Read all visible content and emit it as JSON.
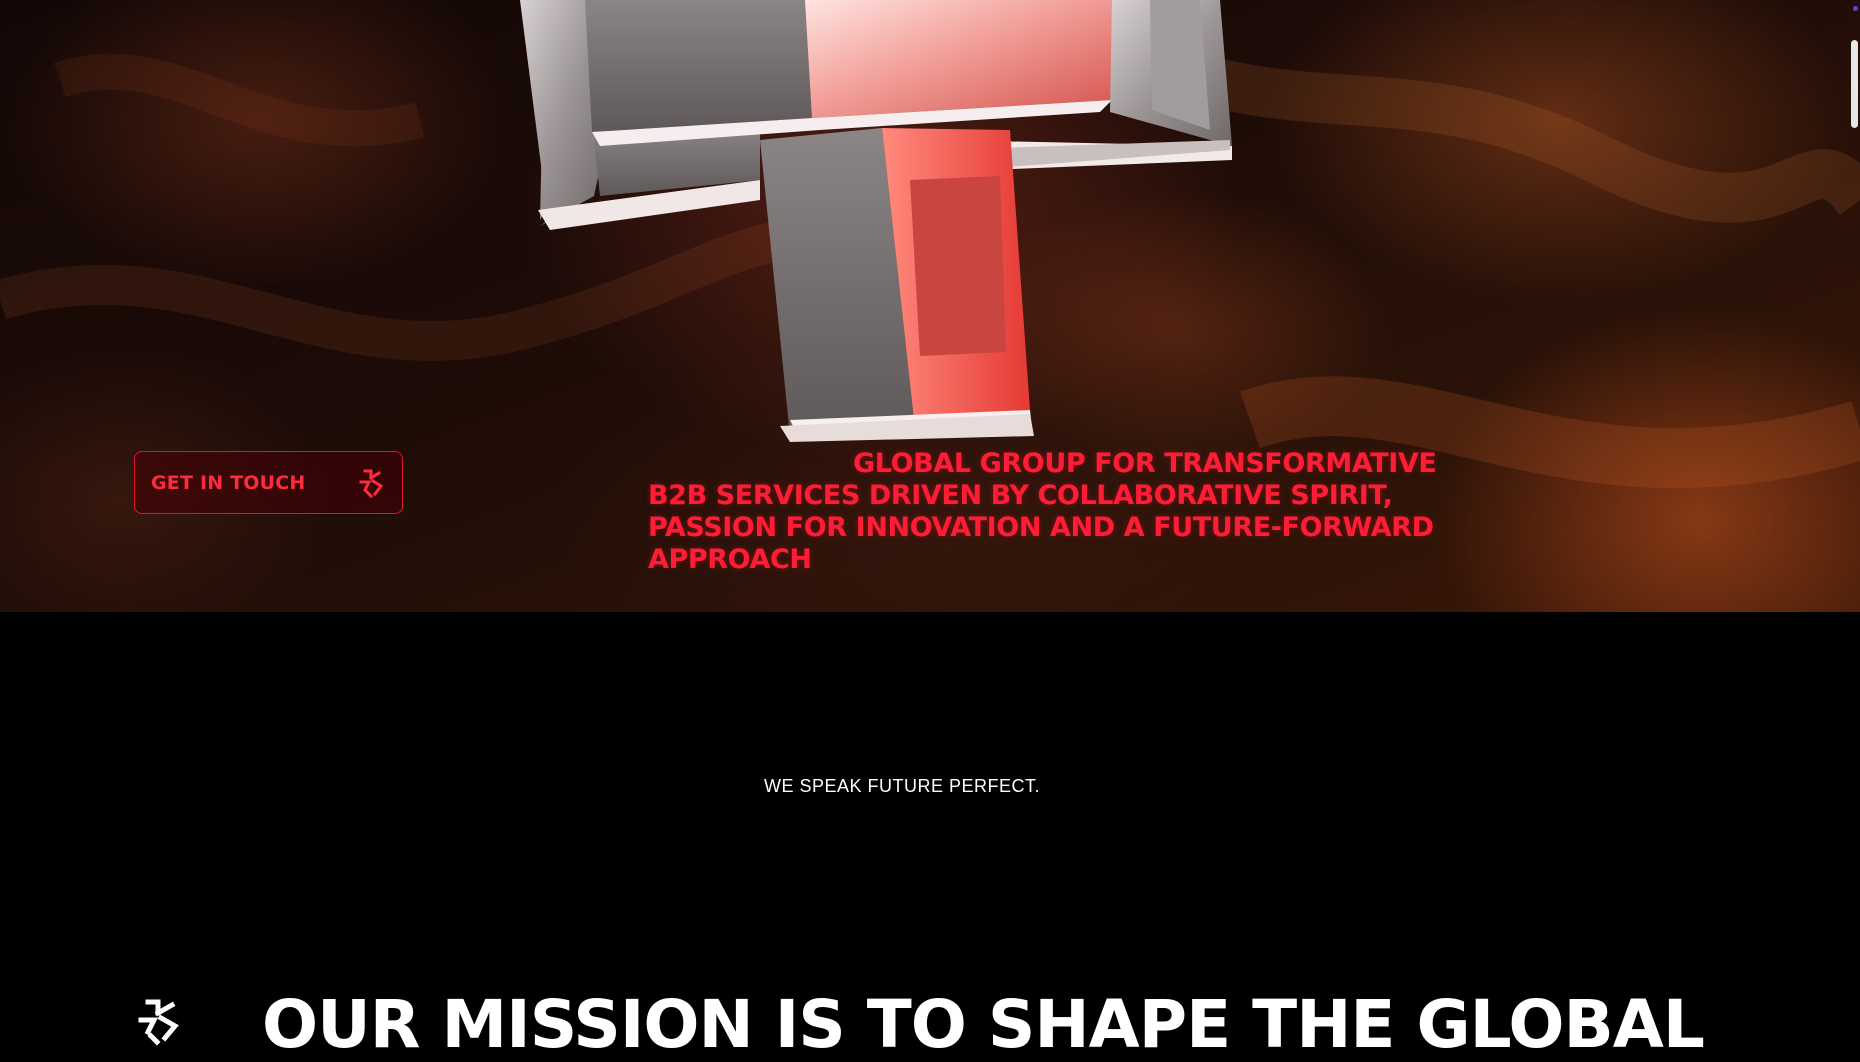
{
  "hero": {
    "cta_label": "GET IN TOUCH",
    "cta_icon": "brand-mark-icon",
    "tagline": "GLOBAL GROUP FOR TRANSFORMATIVE B2B SERVICES DRIVEN BY COLLABORATIVE SPIRIT, PASSION FOR INNOVATION AND A FUTURE-FORWARD APPROACH",
    "artwork": "3d-interlocking-frames"
  },
  "slogan": "WE SPEAK FUTURE PERFECT.",
  "mission": {
    "logo": "brand-mark-icon",
    "heading": "OUR MISSION IS TO SHAPE THE GLOBAL"
  },
  "colors": {
    "accent_red": "#ff1c35",
    "background": "#000000",
    "text_white": "#ffffff"
  }
}
